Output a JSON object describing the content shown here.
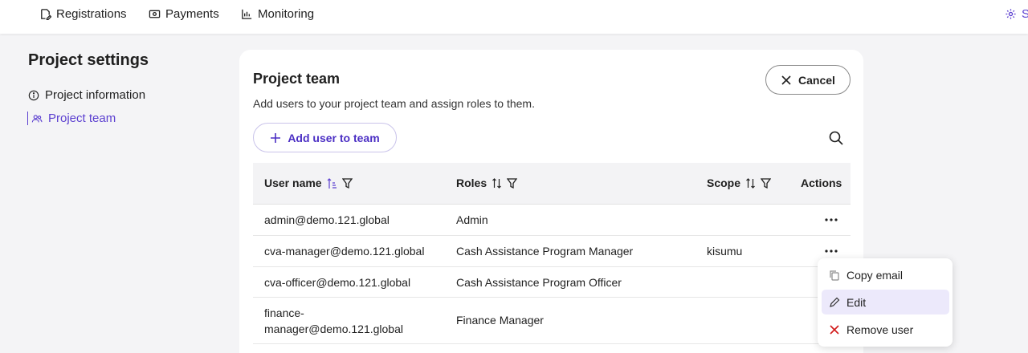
{
  "topnav": {
    "registrations": "Registrations",
    "payments": "Payments",
    "monitoring": "Monitoring",
    "settings_partial": "Se"
  },
  "sidebar": {
    "title": "Project settings",
    "items": [
      {
        "label": "Project information",
        "icon": "info-circle-icon"
      },
      {
        "label": "Project team",
        "icon": "team-icon",
        "active": true
      }
    ]
  },
  "card": {
    "title": "Project team",
    "description": "Add users to your project team and assign roles to them.",
    "cancel_label": "Cancel",
    "add_label": "Add user to team"
  },
  "table": {
    "columns": [
      "User name",
      "Roles",
      "Scope",
      "Actions"
    ],
    "rows": [
      {
        "user": "admin@demo.121.global",
        "role": "Admin",
        "scope": ""
      },
      {
        "user": "cva-manager@demo.121.global",
        "role": "Cash Assistance Program Manager",
        "scope": "kisumu"
      },
      {
        "user": "cva-officer@demo.121.global",
        "role": "Cash Assistance Program Officer",
        "scope": ""
      },
      {
        "user_line1": "finance-",
        "user_line2": "manager@demo.121.global",
        "role": "Finance Manager",
        "scope": ""
      }
    ]
  },
  "context_menu": {
    "copy_email": "Copy email",
    "edit": "Edit",
    "remove_user": "Remove user"
  },
  "colors": {
    "accent": "#5b3fd0",
    "danger": "#d11a1a",
    "menu_hover": "#ece9fb"
  }
}
